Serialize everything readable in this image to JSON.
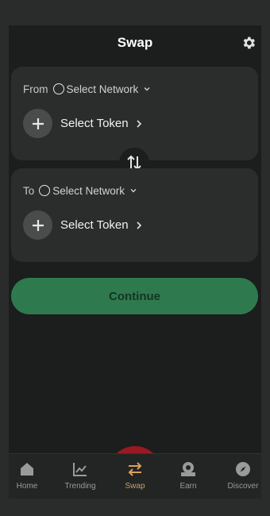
{
  "header": {
    "title": "Swap",
    "settings_icon": "gear-icon"
  },
  "from_card": {
    "label": "From",
    "network": "Select Network",
    "token": "Select Token"
  },
  "to_card": {
    "label": "To",
    "network": "Select Network",
    "token": "Select Token"
  },
  "swap_direction_icon": "swap-vertical-icon",
  "continue_label": "Continue",
  "nav": {
    "items": [
      {
        "label": "Home",
        "icon": "home-icon"
      },
      {
        "label": "Trending",
        "icon": "chart-icon"
      },
      {
        "label": "Swap",
        "icon": "swap-icon",
        "active": true
      },
      {
        "label": "Earn",
        "icon": "earn-icon"
      },
      {
        "label": "Discover",
        "icon": "compass-icon"
      }
    ]
  },
  "colors": {
    "background": "#1c1d1d",
    "card": "#2b2c2c",
    "continue_button": "#2e7a4e",
    "active_nav": "#c8a064",
    "tap_highlight": "#af1923"
  }
}
